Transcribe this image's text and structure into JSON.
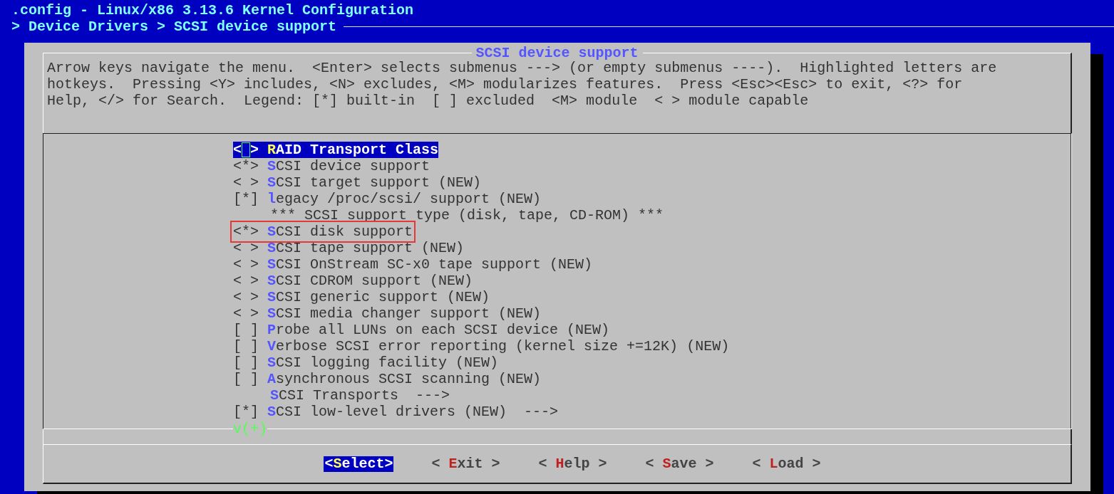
{
  "window": {
    "title": ".config - Linux/x86 3.13.6 Kernel Configuration"
  },
  "breadcrumb": "> Device Drivers > SCSI device support",
  "dialog": {
    "title": "SCSI device support",
    "help_lines": [
      "Arrow keys navigate the menu.  <Enter> selects submenus ---> (or empty submenus ----).  Highlighted letters are",
      "hotkeys.  Pressing <Y> includes, <N> excludes, <M> modularizes features.  Press <Esc><Esc> to exit, <?> for",
      "Help, </> for Search.  Legend: [*] built-in  [ ] excluded  <M> module  < > module capable"
    ],
    "items": [
      {
        "kind": "option",
        "prefix": "< >",
        "label": "**R**AID Transport Class",
        "selected": true,
        "marked": false
      },
      {
        "kind": "option",
        "prefix": "<*>",
        "label": "**S**CSI device support",
        "selected": false,
        "marked": false
      },
      {
        "kind": "option",
        "prefix": "< >",
        "label": "**S**CSI target support (NEW)",
        "selected": false,
        "marked": false
      },
      {
        "kind": "option",
        "prefix": "[*]",
        "label": "**l**egacy /proc/scsi/ support (NEW)",
        "selected": false,
        "marked": false
      },
      {
        "kind": "comment",
        "label": "*** SCSI support type (disk, tape, CD-ROM) ***",
        "selected": false,
        "marked": false
      },
      {
        "kind": "option",
        "prefix": "<*>",
        "label": "**S**CSI disk support",
        "selected": false,
        "marked": true
      },
      {
        "kind": "option",
        "prefix": "< >",
        "label": "**S**CSI tape support (NEW)",
        "selected": false,
        "marked": false
      },
      {
        "kind": "option",
        "prefix": "< >",
        "label": "**S**CSI OnStream SC-x0 tape support (NEW)",
        "selected": false,
        "marked": false
      },
      {
        "kind": "option",
        "prefix": "< >",
        "label": "**S**CSI CDROM support (NEW)",
        "selected": false,
        "marked": false
      },
      {
        "kind": "option",
        "prefix": "< >",
        "label": "**S**CSI generic support (NEW)",
        "selected": false,
        "marked": false
      },
      {
        "kind": "option",
        "prefix": "< >",
        "label": "**S**CSI media changer support (NEW)",
        "selected": false,
        "marked": false
      },
      {
        "kind": "option",
        "prefix": "[ ]",
        "label": "**P**robe all LUNs on each SCSI device (NEW)",
        "selected": false,
        "marked": false
      },
      {
        "kind": "option",
        "prefix": "[ ]",
        "label": "**V**erbose SCSI error reporting (kernel size +=12K) (NEW)",
        "selected": false,
        "marked": false
      },
      {
        "kind": "option",
        "prefix": "[ ]",
        "label": "**S**CSI logging facility (NEW)",
        "selected": false,
        "marked": false
      },
      {
        "kind": "option",
        "prefix": "[ ]",
        "label": "**A**synchronous SCSI scanning (NEW)",
        "selected": false,
        "marked": false
      },
      {
        "kind": "menu",
        "label": "**S**CSI Transports  --->",
        "selected": false,
        "marked": false
      },
      {
        "kind": "option",
        "prefix": "[*]",
        "label": "**S**CSI low-level drivers (NEW)  --->",
        "selected": false,
        "marked": false
      }
    ],
    "more_indicator": "v(+)",
    "buttons": [
      {
        "label": "<**S**elect>",
        "selected": true
      },
      {
        "label": "< **E**xit >",
        "selected": false
      },
      {
        "label": "< **H**elp >",
        "selected": false
      },
      {
        "label": "< **S**ave >",
        "selected": false
      },
      {
        "label": "< **L**oad >",
        "selected": false
      }
    ]
  }
}
